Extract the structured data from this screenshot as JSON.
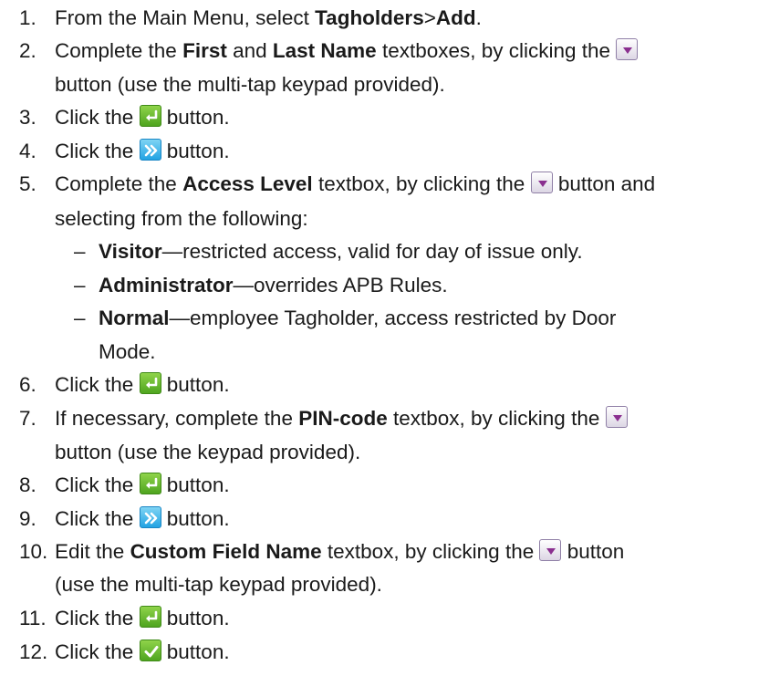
{
  "steps": [
    {
      "num": "1.",
      "parts": [
        {
          "t": "From the Main Menu, select "
        },
        {
          "b": "Tagholders"
        },
        {
          "t": ">"
        },
        {
          "b": "Add"
        },
        {
          "t": "."
        }
      ]
    },
    {
      "num": "2.",
      "parts": [
        {
          "t": "Complete the "
        },
        {
          "b": "First"
        },
        {
          "t": " and "
        },
        {
          "b": "Last Name"
        },
        {
          "t": " textboxes, by clicking the "
        },
        {
          "icon": "dropdown-icon"
        }
      ]
    },
    {
      "num": "",
      "parts": [
        {
          "t": "button (use the multi-tap keypad provided)."
        }
      ]
    },
    {
      "num": "3.",
      "parts": [
        {
          "t": "Click the "
        },
        {
          "icon": "enter-icon"
        },
        {
          "t": " button."
        }
      ]
    },
    {
      "num": "4.",
      "parts": [
        {
          "t": "Click the "
        },
        {
          "icon": "next-icon"
        },
        {
          "t": " button."
        }
      ]
    },
    {
      "num": "5.",
      "parts": [
        {
          "t": "Complete the "
        },
        {
          "b": "Access Level"
        },
        {
          "t": " textbox, by clicking the "
        },
        {
          "icon": "dropdown-icon"
        },
        {
          "t": " button and"
        }
      ]
    },
    {
      "num": "",
      "parts": [
        {
          "t": "selecting from the following:"
        }
      ]
    },
    {
      "sub": true,
      "parts": [
        {
          "b": "Visitor"
        },
        {
          "t": "—restricted access, valid for day of issue only."
        }
      ]
    },
    {
      "sub": true,
      "parts": [
        {
          "b": "Administrator"
        },
        {
          "t": "—overrides APB Rules."
        }
      ]
    },
    {
      "sub": true,
      "parts": [
        {
          "b": "Normal"
        },
        {
          "t": "—employee Tagholder, access restricted by Door"
        }
      ]
    },
    {
      "sub": true,
      "nodash": true,
      "parts": [
        {
          "t": "Mode."
        }
      ]
    },
    {
      "num": "6.",
      "parts": [
        {
          "t": "Click the "
        },
        {
          "icon": "enter-icon"
        },
        {
          "t": " button."
        }
      ]
    },
    {
      "num": "7.",
      "parts": [
        {
          "t": "If necessary, complete the "
        },
        {
          "b": "PIN-code"
        },
        {
          "t": " textbox, by clicking the "
        },
        {
          "icon": "dropdown-icon"
        }
      ]
    },
    {
      "num": "",
      "parts": [
        {
          "t": "button (use the keypad provided)."
        }
      ]
    },
    {
      "num": "8.",
      "parts": [
        {
          "t": "Click the "
        },
        {
          "icon": "enter-icon"
        },
        {
          "t": " button."
        }
      ]
    },
    {
      "num": "9.",
      "parts": [
        {
          "t": "Click the "
        },
        {
          "icon": "next-icon"
        },
        {
          "t": " button."
        }
      ]
    },
    {
      "num": "10.",
      "parts": [
        {
          "t": "Edit the "
        },
        {
          "b": "Custom Field Name"
        },
        {
          "t": " textbox, by clicking the "
        },
        {
          "icon": "dropdown-icon"
        },
        {
          "t": " button"
        }
      ]
    },
    {
      "num": "",
      "parts": [
        {
          "t": "(use the multi-tap keypad provided)."
        }
      ]
    },
    {
      "num": "11.",
      "parts": [
        {
          "t": "Click the "
        },
        {
          "icon": "enter-icon"
        },
        {
          "t": " button."
        }
      ]
    },
    {
      "num": "12.",
      "parts": [
        {
          "t": "Click the "
        },
        {
          "icon": "confirm-check-icon"
        },
        {
          "t": " button."
        }
      ]
    }
  ],
  "dash_char": "–"
}
